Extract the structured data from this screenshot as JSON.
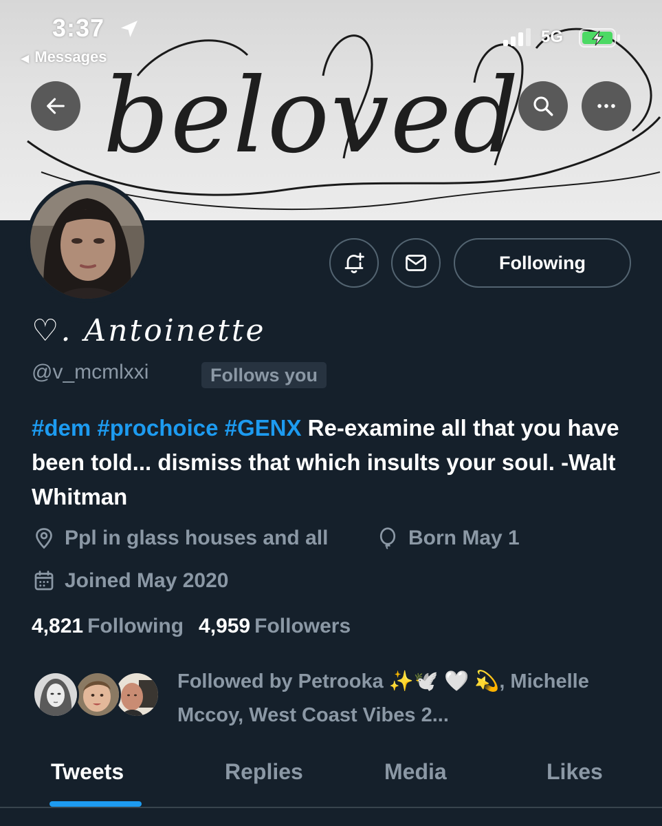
{
  "status_bar": {
    "time": "3:37",
    "back_label": "Messages",
    "network": "5G"
  },
  "banner": {
    "text": "beloved"
  },
  "profile": {
    "display_name": "♡. Antoinette",
    "handle": "@v_mcmlxxi",
    "follows_you_badge": "Follows you",
    "bio": {
      "hashtags": [
        "#dem",
        "#prochoice",
        "#GENX"
      ],
      "text": "Re-examine all that you have been told... dismiss that which insults your soul. -Walt Whitman"
    },
    "location": "Ppl in glass houses and all",
    "birthday": "Born May 1",
    "joined": "Joined May 2020",
    "following_count": "4,821",
    "following_label": "Following",
    "followers_count": "4,959",
    "followers_label": "Followers",
    "followed_by": "Followed by Petrooka ✨🕊️ 🤍 💫, Michelle Mccoy, West Coast Vibes 2..."
  },
  "actions": {
    "following_button": "Following"
  },
  "tabs": [
    {
      "label": "Tweets",
      "active": true
    },
    {
      "label": "Replies",
      "active": false
    },
    {
      "label": "Media",
      "active": false
    },
    {
      "label": "Likes",
      "active": false
    }
  ],
  "colors": {
    "background": "#15202b",
    "accent": "#1d9bf0",
    "secondary_text": "#8b98a5",
    "border": "#536471",
    "battery_charging": "#4cd964"
  }
}
